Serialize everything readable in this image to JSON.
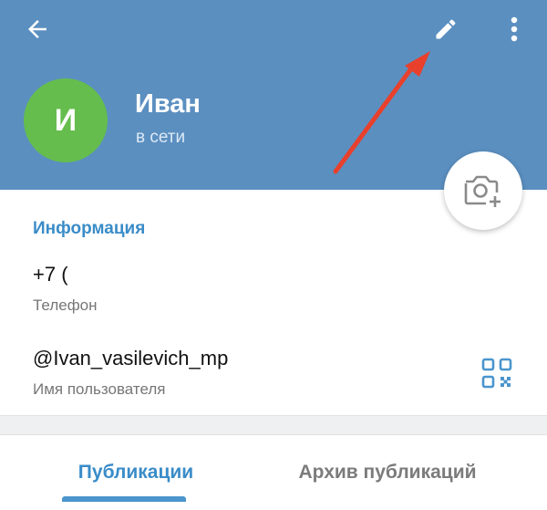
{
  "header": {
    "background_color": "#5b8fc0",
    "back_icon": "arrow-left-icon",
    "edit_icon": "pencil-icon",
    "more_icon": "more-vertical-icon"
  },
  "profile": {
    "avatar_initial": "И",
    "avatar_color": "#65bd4e",
    "name": "Иван",
    "status": "в сети"
  },
  "camera_button": {
    "icon": "camera-add-icon"
  },
  "info": {
    "section_title": "Информация",
    "phone_value": "+7 (",
    "phone_label": "Телефон",
    "username_value": "@Ivan_vasilevich_mp",
    "username_label": "Имя пользователя",
    "qr_icon": "qr-code-icon"
  },
  "tabs": [
    {
      "label": "Публикации",
      "active": true
    },
    {
      "label": "Архив публикаций",
      "active": false
    }
  ],
  "colors": {
    "accent": "#3a8cc8",
    "annotation_arrow": "#e8402c"
  }
}
